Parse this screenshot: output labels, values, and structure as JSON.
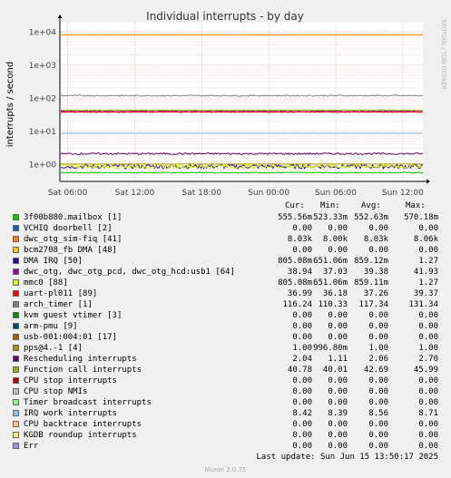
{
  "chart_data": {
    "type": "line",
    "title": "Individual interrupts - by day",
    "ylabel": "interrupts / second",
    "side_label": "RRDTOOL / TOBI OETIKER",
    "yscale": "log",
    "ylim": [
      0.3,
      20000
    ],
    "yticks": [
      "1e+04",
      "1e+03",
      "1e+02",
      "1e+01",
      "1e+00"
    ],
    "ytick_values": [
      10000,
      1000,
      100,
      10,
      1
    ],
    "xticks": [
      "Sat 06:00",
      "Sat 12:00",
      "Sat 18:00",
      "Sun 00:00",
      "Sun 06:00",
      "Sun 12:00"
    ],
    "xtick_hours": [
      6,
      12,
      18,
      24,
      30,
      36
    ],
    "xlim_hours": [
      5.3,
      37.8
    ],
    "grid": true,
    "columns": [
      "Cur:",
      "Min:",
      "Avg:",
      "Max:"
    ],
    "series": [
      {
        "name": "3f00b880.mailbox [1]",
        "color": "#00cc00",
        "cur": "555.56m",
        "min": "523.33m",
        "avg": "552.63m",
        "max": "570.18m",
        "level": 0.553,
        "noise": 0.03
      },
      {
        "name": "VCHIQ doorbell [2]",
        "color": "#0066b3",
        "cur": "0.00",
        "min": "0.00",
        "avg": "0.00",
        "max": "0.00",
        "level": 0,
        "noise": 0
      },
      {
        "name": "dwc_otg_sim-fiq [41]",
        "color": "#ff8000",
        "cur": "8.03k",
        "min": "8.00k",
        "avg": "8.03k",
        "max": "8.06k",
        "level": 8030,
        "noise": 0.003
      },
      {
        "name": "bcm2708_fb DMA [48]",
        "color": "#ffcc00",
        "cur": "0.00",
        "min": "0.00",
        "avg": "0.00",
        "max": "0.00",
        "level": 0,
        "noise": 0
      },
      {
        "name": "DMA IRQ [50]",
        "color": "#330099",
        "cur": "805.08m",
        "min": "651.06m",
        "avg": "859.12m",
        "max": "1.27",
        "level": 0.859,
        "noise": 0.15
      },
      {
        "name": "dwc_otg, dwc_otg_pcd, dwc_otg_hcd:usb1 [64]",
        "color": "#990099",
        "cur": "38.94",
        "min": "37.03",
        "avg": "39.38",
        "max": "41.93",
        "level": 39.38,
        "noise": 0.03
      },
      {
        "name": "mmc0 [88]",
        "color": "#ccff00",
        "cur": "805.08m",
        "min": "651.06m",
        "avg": "859.11m",
        "max": "1.27",
        "level": 0.859,
        "noise": 0.15
      },
      {
        "name": "uart-pl011 [89]",
        "color": "#ff0000",
        "cur": "36.99",
        "min": "36.18",
        "avg": "37.26",
        "max": "39.37",
        "level": 37.26,
        "noise": 0.03
      },
      {
        "name": "arch_timer [1]",
        "color": "#808080",
        "cur": "116.24",
        "min": "110.33",
        "avg": "117.34",
        "max": "131.34",
        "level": 117.34,
        "noise": 0.04
      },
      {
        "name": "kvm guest vtimer [3]",
        "color": "#008f00",
        "cur": "0.00",
        "min": "0.00",
        "avg": "0.00",
        "max": "0.00",
        "level": 0,
        "noise": 0
      },
      {
        "name": "arm-pmu [9]",
        "color": "#00487d",
        "cur": "0.00",
        "min": "0.00",
        "avg": "0.00",
        "max": "0.00",
        "level": 0,
        "noise": 0
      },
      {
        "name": "usb-001:004:01 [17]",
        "color": "#b35a00",
        "cur": "0.00",
        "min": "0.00",
        "avg": "0.00",
        "max": "0.00",
        "level": 0,
        "noise": 0
      },
      {
        "name": "pps@4.-1 [4]",
        "color": "#b38f00",
        "cur": "1.00",
        "min": "996.80m",
        "avg": "1.00",
        "max": "1.00",
        "level": 1.0,
        "noise": 0.003
      },
      {
        "name": "Rescheduling interrupts",
        "color": "#6b006b",
        "cur": "2.04",
        "min": "1.11",
        "avg": "2.06",
        "max": "2.70",
        "level": 2.06,
        "noise": 0.06
      },
      {
        "name": "Function call interrupts",
        "color": "#8fb300",
        "cur": "40.78",
        "min": "40.01",
        "avg": "42.69",
        "max": "45.99",
        "level": 42.69,
        "noise": 0.03
      },
      {
        "name": "CPU stop interrupts",
        "color": "#b30000",
        "cur": "0.00",
        "min": "0.00",
        "avg": "0.00",
        "max": "0.00",
        "level": 0,
        "noise": 0
      },
      {
        "name": "CPU stop NMIs",
        "color": "#bebebe",
        "cur": "0.00",
        "min": "0.00",
        "avg": "0.00",
        "max": "0.00",
        "level": 0,
        "noise": 0
      },
      {
        "name": "Timer broadcast interrupts",
        "color": "#80ff80",
        "cur": "0.00",
        "min": "0.00",
        "avg": "0.00",
        "max": "0.00",
        "level": 0,
        "noise": 0
      },
      {
        "name": "IRQ work interrupts",
        "color": "#80c9ff",
        "cur": "8.42",
        "min": "8.39",
        "avg": "8.56",
        "max": "8.71",
        "level": 8.56,
        "noise": 0.01
      },
      {
        "name": "CPU backtrace interrupts",
        "color": "#ffc080",
        "cur": "0.00",
        "min": "0.00",
        "avg": "0.00",
        "max": "0.00",
        "level": 0,
        "noise": 0
      },
      {
        "name": "KGDB roundup interrupts",
        "color": "#ffe680",
        "cur": "0.00",
        "min": "0.00",
        "avg": "0.00",
        "max": "0.00",
        "level": 0,
        "noise": 0
      },
      {
        "name": "Err",
        "color": "#aa80ff",
        "cur": "0.00",
        "min": "0.00",
        "avg": "0.00",
        "max": "0.00",
        "level": 0,
        "noise": 0
      }
    ]
  },
  "footer": {
    "last_update": "Last update:  Sun Jun 15 13:50:17 2025",
    "munin": "Munin 2.0.75"
  }
}
